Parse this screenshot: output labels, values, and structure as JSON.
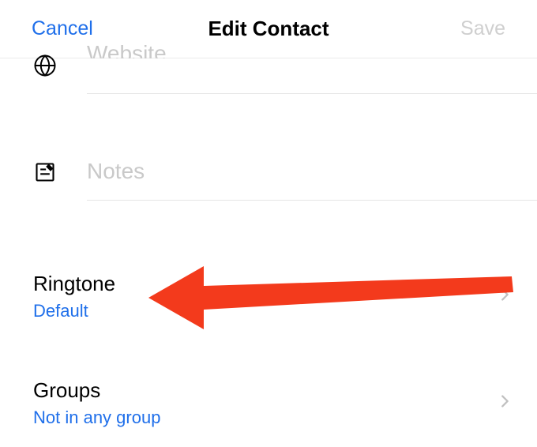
{
  "header": {
    "cancel": "Cancel",
    "title": "Edit Contact",
    "save": "Save"
  },
  "fields": {
    "website": {
      "placeholder": "Website",
      "icon": "globe-icon"
    },
    "notes": {
      "placeholder": "Notes",
      "icon": "note-icon"
    }
  },
  "rows": {
    "ringtone": {
      "title": "Ringtone",
      "value": "Default"
    },
    "groups": {
      "title": "Groups",
      "value": "Not in any group"
    }
  },
  "annotation": {
    "type": "arrow",
    "target": "ringtone-row",
    "color": "#f33a1c"
  }
}
